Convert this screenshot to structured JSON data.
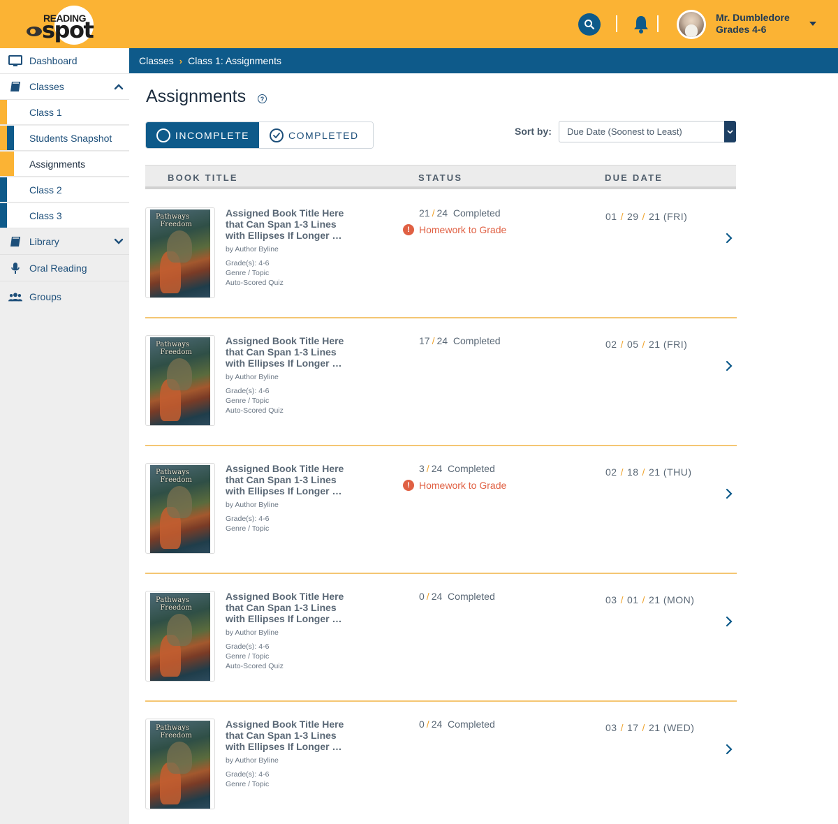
{
  "header": {
    "logo_top": "READING",
    "logo_bottom": "spot",
    "user_name": "Mr. Dumbledore",
    "user_grades": "Grades 4-6",
    "accent_color": "#fbb334",
    "primary_color": "#0e5a8a"
  },
  "sidebar": {
    "dashboard": "Dashboard",
    "classes": "Classes",
    "class1": "Class 1",
    "students_snapshot": "Students Snapshot",
    "assignments": "Assignments",
    "class2": "Class 2",
    "class3": "Class 3",
    "library": "Library",
    "oral_reading": "Oral Reading",
    "groups": "Groups"
  },
  "breadcrumb": {
    "first": "Classes",
    "second": "Class 1: Assignments"
  },
  "page": {
    "title": "Assignments",
    "help": "?",
    "tab_incomplete": "INCOMPLETE",
    "tab_completed": "COMPLETED",
    "sort_label": "Sort by:",
    "sort_value": "Due Date (Soonest to Least)"
  },
  "table": {
    "col_book": "BOOK TITLE",
    "col_status": "STATUS",
    "col_due": "DUE DATE"
  },
  "rows": [
    {
      "cover_title_1": "Pathways",
      "cover_title_2": "Freedom",
      "title": "Assigned Book Title Here that Can Span 1-3 Lines with Ellipses If Longer …",
      "byline": "by Author Byline",
      "grades": "Grade(s): 4-6",
      "genre": "Genre / Topic",
      "quiz": "Auto-Scored Quiz",
      "done": "21",
      "total": "24",
      "completed_label": "Completed",
      "homework": "Homework to Grade",
      "due_m": "01",
      "due_d": "29",
      "due_y": "21",
      "due_dow": "(FRI)"
    },
    {
      "cover_title_1": "Pathways",
      "cover_title_2": "Freedom",
      "title": "Assigned Book Title Here that Can Span 1-3 Lines with Ellipses If Longer …",
      "byline": "by Author Byline",
      "grades": "Grade(s): 4-6",
      "genre": "Genre / Topic",
      "quiz": "Auto-Scored Quiz",
      "done": "17",
      "total": "24",
      "completed_label": "Completed",
      "homework": "",
      "due_m": "02",
      "due_d": "05",
      "due_y": "21",
      "due_dow": "(FRI)"
    },
    {
      "cover_title_1": "Pathways",
      "cover_title_2": "Freedom",
      "title": "Assigned Book Title Here that Can Span 1-3 Lines with Ellipses If Longer …",
      "byline": "by Author Byline",
      "grades": "Grade(s): 4-6",
      "genre": "Genre / Topic",
      "quiz": "",
      "done": "3",
      "total": "24",
      "completed_label": "Completed",
      "homework": "Homework to Grade",
      "due_m": "02",
      "due_d": "18",
      "due_y": "21",
      "due_dow": "(THU)"
    },
    {
      "cover_title_1": "Pathways",
      "cover_title_2": "Freedom",
      "title": "Assigned Book Title Here that Can Span 1-3 Lines with Ellipses If Longer …",
      "byline": "by Author Byline",
      "grades": "Grade(s): 4-6",
      "genre": "Genre / Topic",
      "quiz": "Auto-Scored Quiz",
      "done": "0",
      "total": "24",
      "completed_label": "Completed",
      "homework": "",
      "due_m": "03",
      "due_d": "01",
      "due_y": "21",
      "due_dow": "(MON)"
    },
    {
      "cover_title_1": "Pathways",
      "cover_title_2": "Freedom",
      "title": "Assigned Book Title Here that Can Span 1-3 Lines with Ellipses If Longer …",
      "byline": "by Author Byline",
      "grades": "Grade(s): 4-6",
      "genre": "Genre / Topic",
      "quiz": "",
      "done": "0",
      "total": "24",
      "completed_label": "Completed",
      "homework": "",
      "due_m": "03",
      "due_d": "17",
      "due_y": "21",
      "due_dow": "(WED)"
    }
  ]
}
